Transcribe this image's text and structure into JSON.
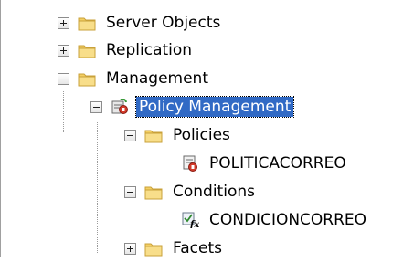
{
  "tree": {
    "server_objects": "Server Objects",
    "replication": "Replication",
    "management": "Management",
    "policy_management": "Policy Management",
    "policies": "Policies",
    "politicacorreo": "POLITICACORREO",
    "conditions": "Conditions",
    "condicioncorreo": "CONDICIONCORREO",
    "facets": "Facets"
  },
  "colors": {
    "selection": "#316ac5",
    "folder": "#f4cf63"
  },
  "icons": {
    "folder": "folder-icon",
    "policy_management": "policy-management-icon",
    "policy": "policy-icon",
    "condition": "condition-icon"
  }
}
